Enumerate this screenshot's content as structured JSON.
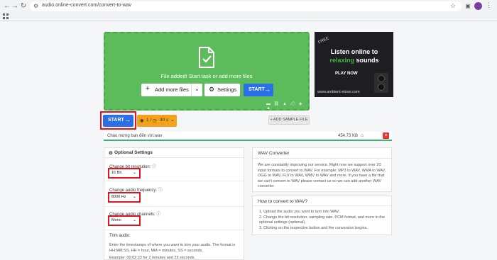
{
  "browser": {
    "url": "audio.online-convert.com/convert-to-wav"
  },
  "upload": {
    "status": "File added! Start task or add more files",
    "add_more_label": "Add more files",
    "settings_label": "Settings",
    "start_label": "START"
  },
  "ad": {
    "badge": "FREE",
    "line1": "Listen online to",
    "line2a": "relaxing",
    "line2b": " sounds",
    "cta": "PLAY NOW",
    "site": "www.ambient-mixer.com"
  },
  "actions": {
    "start_label": "START",
    "credit_count": "1",
    "credit_separator": "/",
    "credit_time": "30",
    "credit_unit": "s",
    "sample_label": "+ ADD SAMPLE FILE"
  },
  "file": {
    "name": "Chào mừng bạn đến với.wav",
    "size": "454.73 KB"
  },
  "options": {
    "title": "Optional Settings",
    "bit_label": "Change bit resolution:",
    "bit_value": "16 Bit",
    "freq_label": "Change audio frequency:",
    "freq_value": "8000 Hz",
    "channels_label": "Change audio channels:",
    "channels_value": "Mono",
    "trim_title": "Trim audio:",
    "trim_desc": "Enter the timestamps of where you want to trim your audio. The format is HH:MM:SS. HH = hour, MM = minutes, SS = seconds.",
    "trim_example": "Example: 00:02:23 for 2 minutes and 23 seconds."
  },
  "wav_info": {
    "title": "WAV Converter",
    "text": "We are constantly improving our service. Right now we support over 20 input formats to convert to WAV. For example: MP3 to WAV, WMA to WAV, OGG to WAV, FLV to WAV, WMV to WAV and more. If you have a file that we can't convert to WAV please contact us so we can add another WAV converter."
  },
  "howto": {
    "title": "How to convert to WAV?",
    "step1": "1. Upload the audio you want to turn into WAV.",
    "step2": "2. Change the bit resolution, sampling rate, PCM format, and more in the optional settings (optional).",
    "step3": "3. Clicking on the respective button and the conversion begins."
  },
  "colors": {
    "green": "#5cbb5a",
    "blue": "#2b6fe8",
    "orange": "#f5a21a",
    "red_highlight": "#e0141e"
  }
}
